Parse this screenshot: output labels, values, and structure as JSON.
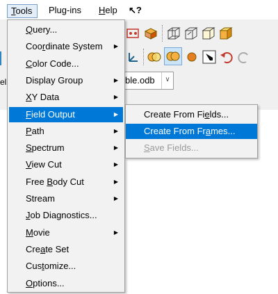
{
  "menubar": {
    "tools": {
      "before": "",
      "u": "T",
      "after": "ools"
    },
    "plugins": {
      "before": "Plug-ins",
      "u": "",
      "after": ""
    },
    "help": {
      "before": "",
      "u": "H",
      "after": "elp"
    },
    "whatsthis": "↖?"
  },
  "toolbar": {
    "odb_file": "ble.odb",
    "left_stub": "el"
  },
  "tools_menu": {
    "items": [
      {
        "before": "",
        "u": "Q",
        "after": "uery...",
        "submenu": false
      },
      {
        "before": "Coo",
        "u": "r",
        "after": "dinate System",
        "submenu": true
      },
      {
        "before": "",
        "u": "C",
        "after": "olor Code...",
        "submenu": false
      },
      {
        "before": "Display Group",
        "u": "",
        "after": "",
        "submenu": true
      },
      {
        "before": "",
        "u": "X",
        "after": "Y Data",
        "submenu": true
      },
      {
        "before": "",
        "u": "F",
        "after": "ield Output",
        "submenu": true
      },
      {
        "before": "",
        "u": "P",
        "after": "ath",
        "submenu": true
      },
      {
        "before": "",
        "u": "S",
        "after": "pectrum",
        "submenu": true
      },
      {
        "before": "",
        "u": "V",
        "after": "iew Cut",
        "submenu": true
      },
      {
        "before": "Free ",
        "u": "B",
        "after": "ody Cut",
        "submenu": true
      },
      {
        "before": "Stream",
        "u": "",
        "after": "",
        "submenu": true
      },
      {
        "before": "",
        "u": "J",
        "after": "ob Diagnostics...",
        "submenu": false
      },
      {
        "before": "",
        "u": "M",
        "after": "ovie",
        "submenu": true
      },
      {
        "before": "Cre",
        "u": "a",
        "after": "te Set",
        "submenu": false
      },
      {
        "before": "Cus",
        "u": "t",
        "after": "omize...",
        "submenu": false
      },
      {
        "before": "",
        "u": "O",
        "after": "ptions...",
        "submenu": false
      }
    ]
  },
  "field_output_submenu": {
    "items": [
      {
        "before": "Create From Fi",
        "u": "e",
        "after": "lds..."
      },
      {
        "before": "Create From Fr",
        "u": "a",
        "after": "mes..."
      },
      {
        "before": "",
        "u": "S",
        "after": "ave Fields..."
      }
    ]
  },
  "colors": {
    "highlight": "#0078d7",
    "menu_bg": "#f2f2f2",
    "disabled": "#9a9a9a"
  }
}
